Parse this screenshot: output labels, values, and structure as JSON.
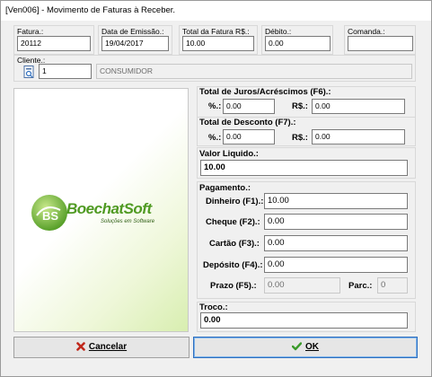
{
  "window": {
    "title": "[Ven006] - Movimento de Faturas à Receber."
  },
  "header": {
    "fatura": {
      "label": "Fatura.:",
      "value": "20112"
    },
    "data_emissao": {
      "label": "Data de Emissão.:",
      "value": "19/04/2017"
    },
    "total_fatura": {
      "label": "Total da Fatura R$.:",
      "value": "10.00"
    },
    "debito": {
      "label": "Débito.:",
      "value": "0.00"
    },
    "comanda": {
      "label": "Comanda.:",
      "value": ""
    }
  },
  "cliente": {
    "label": "Cliente.:",
    "code": "1",
    "name": "CONSUMIDOR"
  },
  "logo": {
    "brand": "BoechatSoft",
    "tagline": "Soluções em Software"
  },
  "juros": {
    "title": "Total de Juros/Acréscimos (F6).:",
    "pct_label": "%.:",
    "pct_value": "0.00",
    "rs_label": "R$.:",
    "rs_value": "0.00"
  },
  "desconto": {
    "title": "Total de Desconto (F7).:",
    "pct_label": "%.:",
    "pct_value": "0.00",
    "rs_label": "R$.:",
    "rs_value": "0.00"
  },
  "valor_liquido": {
    "label": "Valor Liquido.:",
    "value": "10.00"
  },
  "pagamento": {
    "title": "Pagamento.:",
    "dinheiro": {
      "label": "Dinheiro (F1).:",
      "value": "10.00"
    },
    "cheque": {
      "label": "Cheque (F2).:",
      "value": "0.00"
    },
    "cartao": {
      "label": "Cartão (F3).:",
      "value": "0.00"
    },
    "deposito": {
      "label": "Depósito (F4).:",
      "value": "0.00"
    },
    "prazo": {
      "label": "Prazo (F5).:",
      "value": "0.00"
    },
    "parc": {
      "label": "Parc.:",
      "value": "0"
    }
  },
  "troco": {
    "label": "Troco.:",
    "value": "0.00"
  },
  "buttons": {
    "cancelar": {
      "label": "Cancelar",
      "icon": "x-icon",
      "color": "#c0281c"
    },
    "ok": {
      "label": "OK",
      "icon": "check-icon",
      "color": "#3a9a2a"
    }
  },
  "colors": {
    "accent": "#2f6fbf",
    "logo_green": "#5aa82a"
  }
}
